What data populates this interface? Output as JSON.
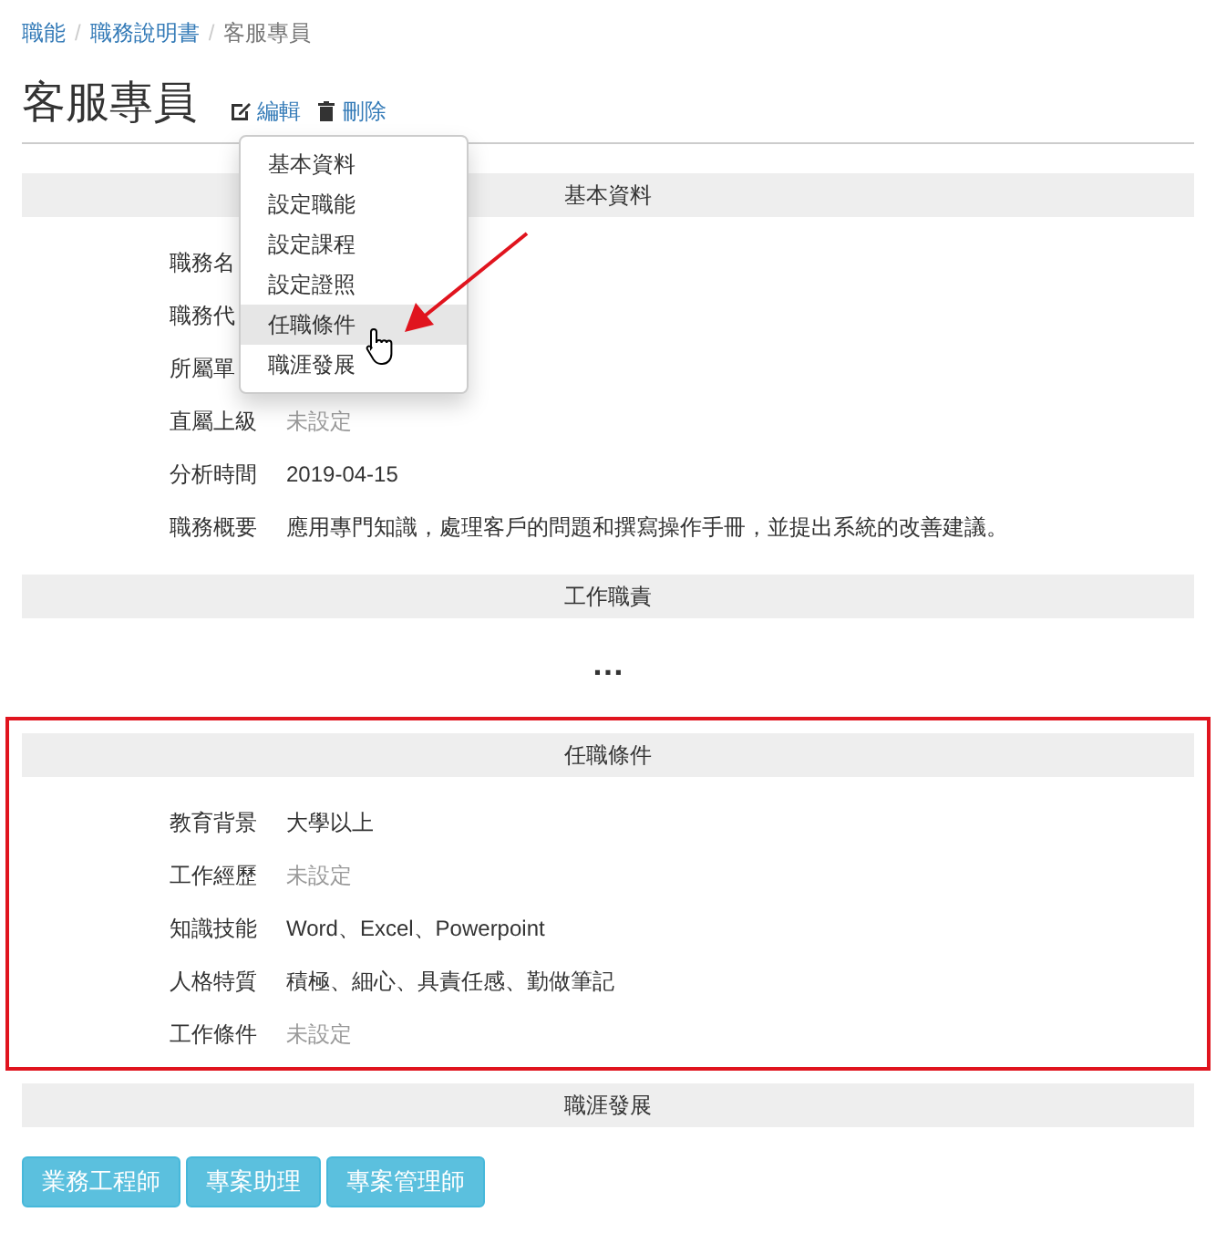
{
  "breadcrumb": [
    {
      "label": "職能",
      "separator": "/",
      "current": false
    },
    {
      "label": "職務說明書",
      "separator": "/",
      "current": false
    },
    {
      "label": "客服專員",
      "current": true
    }
  ],
  "title": "客服專員",
  "actions": [
    {
      "kind": "edit",
      "label": "編輯"
    },
    {
      "kind": "delete",
      "label": "刪除"
    }
  ],
  "menu": [
    {
      "label": "基本資料",
      "selected": false
    },
    {
      "label": "設定職能",
      "selected": false
    },
    {
      "label": "設定課程",
      "selected": false
    },
    {
      "label": "設定證照",
      "selected": false
    },
    {
      "label": "任職條件",
      "selected": true
    },
    {
      "label": "職涯發展",
      "selected": false
    }
  ],
  "sections": [
    {
      "title": "基本資料",
      "highlighted": false,
      "rows": [
        {
          "label": "職務名"
        },
        {
          "label": "職務代"
        },
        {
          "label": "所屬單"
        },
        {
          "label": "直屬上級",
          "value": "未設定",
          "muted": true
        },
        {
          "label": "分析時間",
          "value": "2019-04-15",
          "muted": false
        },
        {
          "label": "職務概要",
          "value": "應用專門知識，處理客戶的問題和撰寫操作手冊，並提出系統的改善建議。",
          "muted": false
        }
      ]
    },
    {
      "title": "工作職責",
      "highlighted": false,
      "ellipsis": "…"
    },
    {
      "title": "任職條件",
      "highlighted": true,
      "rows": [
        {
          "label": "教育背景",
          "value": "大學以上",
          "muted": false
        },
        {
          "label": "工作經歷",
          "value": "未設定",
          "muted": true
        },
        {
          "label": "知識技能",
          "value": "Word、Excel、Powerpoint",
          "muted": false
        },
        {
          "label": "人格特質",
          "value": "積極、細心、具責任感、勤做筆記",
          "muted": false
        },
        {
          "label": "工作條件",
          "value": "未設定",
          "muted": true
        }
      ]
    },
    {
      "title": "職涯發展",
      "highlighted": false,
      "buttons": [
        "業務工程師",
        "專案助理",
        "專案管理師"
      ]
    }
  ]
}
